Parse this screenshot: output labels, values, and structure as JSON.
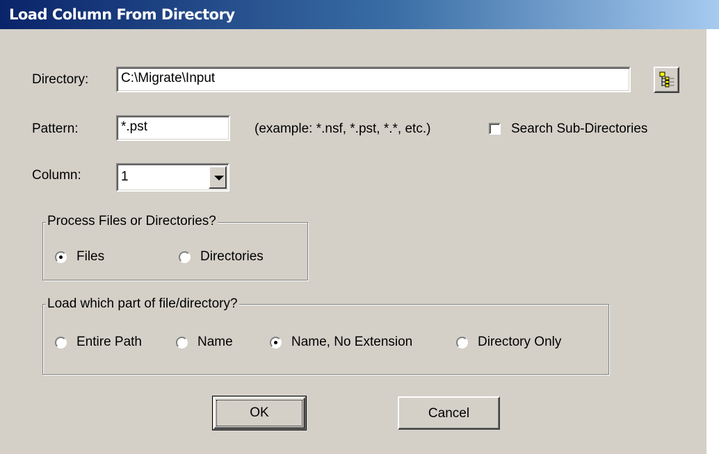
{
  "window": {
    "title": "Load Column From Directory"
  },
  "directory": {
    "label": "Directory:",
    "value": "C:\\Migrate\\Input",
    "browse_icon": "folder-tree-icon"
  },
  "pattern": {
    "label": "Pattern:",
    "value": "*.pst",
    "example": "(example: *.nsf, *.pst, *.*, etc.)"
  },
  "search_sub": {
    "label": "Search Sub-Directories",
    "checked": false
  },
  "column": {
    "label": "Column:",
    "value": "1"
  },
  "process_group": {
    "legend": "Process Files or Directories?",
    "options": [
      {
        "label": "Files",
        "selected": true
      },
      {
        "label": "Directories",
        "selected": false
      }
    ]
  },
  "load_group": {
    "legend": "Load which part of file/directory?",
    "options": [
      {
        "label": "Entire Path",
        "selected": false
      },
      {
        "label": "Name",
        "selected": false
      },
      {
        "label": "Name, No Extension",
        "selected": true
      },
      {
        "label": "Directory Only",
        "selected": false
      }
    ]
  },
  "buttons": {
    "ok": "OK",
    "cancel": "Cancel"
  },
  "colors": {
    "face": "#d4d0c8",
    "title_start": "#0a246a",
    "title_end": "#a6caf0"
  }
}
